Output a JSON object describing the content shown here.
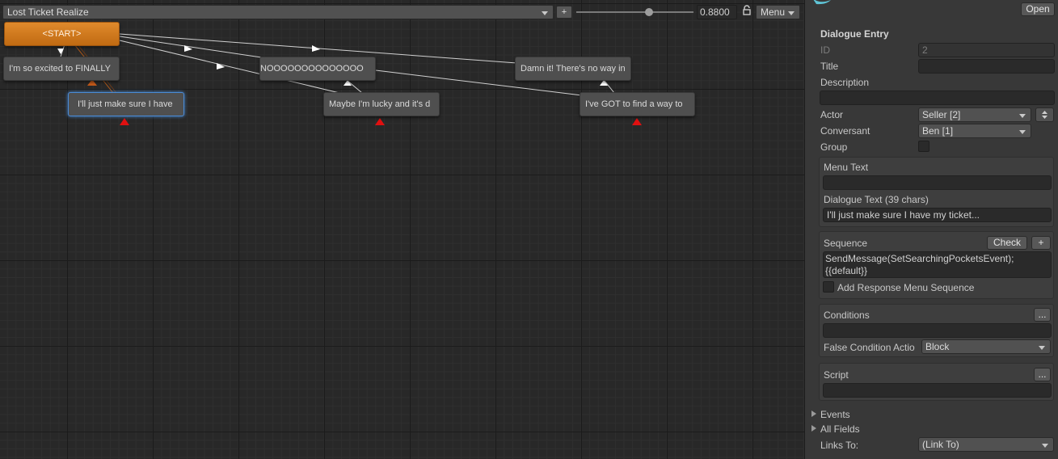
{
  "toolbar": {
    "conversation_title": "Lost Ticket Realize",
    "add_label": "+",
    "zoom_value": "0.8800",
    "zoom_fraction": 0.62,
    "menu_label": "Menu"
  },
  "graph": {
    "nodes": {
      "start": "<START>",
      "excited": "I'm so excited to FINALLY",
      "make_sure": "I'll just make sure I have",
      "nooo": "NOOOOOOOOOOOOOO",
      "lucky": "Maybe I'm lucky and it's d",
      "damn": "Damn it! There's no way in",
      "got_to_find": "I've GOT to find a way to"
    }
  },
  "inspector": {
    "open_button": "Open",
    "section_title": "Dialogue Entry",
    "id_label": "ID",
    "id_value": "2",
    "title_label": "Title",
    "title_value": "",
    "description_label": "Description",
    "description_value": "",
    "actor_label": "Actor",
    "actor_value": "Seller [2]",
    "conversant_label": "Conversant",
    "conversant_value": "Ben [1]",
    "group_label": "Group",
    "menu_text_label": "Menu Text",
    "menu_text_value": "",
    "dialogue_text_label": "Dialogue Text (39 chars)",
    "dialogue_text_value": "I'll just make sure I have my ticket...",
    "sequence_label": "Sequence",
    "check_button": "Check",
    "plus_button": "+",
    "sequence_line1": "SendMessage(SetSearchingPocketsEvent);",
    "sequence_line2": "{{default}}",
    "add_response_label": "Add Response Menu Sequence",
    "conditions_label": "Conditions",
    "ellipsis_button": "...",
    "false_condition_label": "False Condition Actio",
    "false_condition_value": "Block",
    "script_label": "Script",
    "events_label": "Events",
    "all_fields_label": "All Fields",
    "links_to_label": "Links To:",
    "links_to_value": "(Link To)"
  },
  "colors": {
    "start_node": "#d4791d",
    "node": "#4f4f4f",
    "selected_outline": "#4a8bd6",
    "arrow_red": "#e01010",
    "arrow_blue": "#1f3fe0"
  }
}
